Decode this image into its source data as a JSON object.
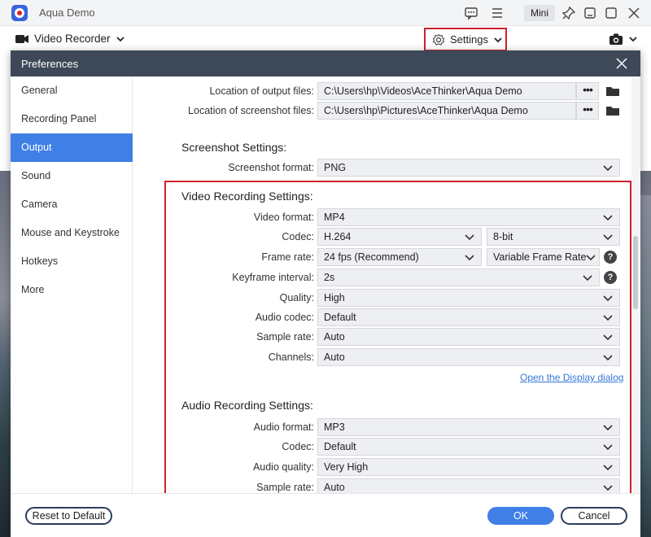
{
  "app": {
    "title": "Aqua Demo",
    "mini_label": "Mini"
  },
  "toolbar": {
    "recorder_label": "Video Recorder",
    "settings_label": "Settings"
  },
  "dialog": {
    "title": "Preferences",
    "sidebar": [
      "General",
      "Recording Panel",
      "Output",
      "Sound",
      "Camera",
      "Mouse and Keystroke",
      "Hotkeys",
      "More"
    ],
    "active_item": "Output",
    "output_files": {
      "label": "Location of output files:",
      "value": "C:\\Users\\hp\\Videos\\AceThinker\\Aqua Demo"
    },
    "screenshot_files": {
      "label": "Location of screenshot files:",
      "value": "C:\\Users\\hp\\Pictures\\AceThinker\\Aqua Demo"
    },
    "screenshot_section": {
      "title": "Screenshot Settings:",
      "format_label": "Screenshot format:",
      "format_value": "PNG"
    },
    "video_section": {
      "title": "Video Recording Settings:",
      "format_label": "Video format:",
      "format_value": "MP4",
      "codec_label": "Codec:",
      "codec_value": "H.264",
      "bitdepth_value": "8-bit",
      "framerate_label": "Frame rate:",
      "framerate_value": "24 fps (Recommend)",
      "framerate_mode": "Variable Frame Rate",
      "keyframe_label": "Keyframe interval:",
      "keyframe_value": "2s",
      "quality_label": "Quality:",
      "quality_value": "High",
      "audio_codec_label": "Audio codec:",
      "audio_codec_value": "Default",
      "sample_rate_label": "Sample rate:",
      "sample_rate_value": "Auto",
      "channels_label": "Channels:",
      "channels_value": "Auto",
      "display_link": "Open the Display dialog"
    },
    "audio_section": {
      "title": "Audio Recording Settings:",
      "format_label": "Audio format:",
      "format_value": "MP3",
      "codec_label": "Codec:",
      "codec_value": "Default",
      "quality_label": "Audio quality:",
      "quality_value": "Very High",
      "sample_rate_label": "Sample rate:",
      "sample_rate_value": "Auto"
    },
    "buttons": {
      "reset": "Reset to Default",
      "ok": "OK",
      "cancel": "Cancel"
    }
  },
  "colors": {
    "accent": "#3f7fe6",
    "highlight_border": "#d0202a",
    "header": "#3d4958"
  }
}
